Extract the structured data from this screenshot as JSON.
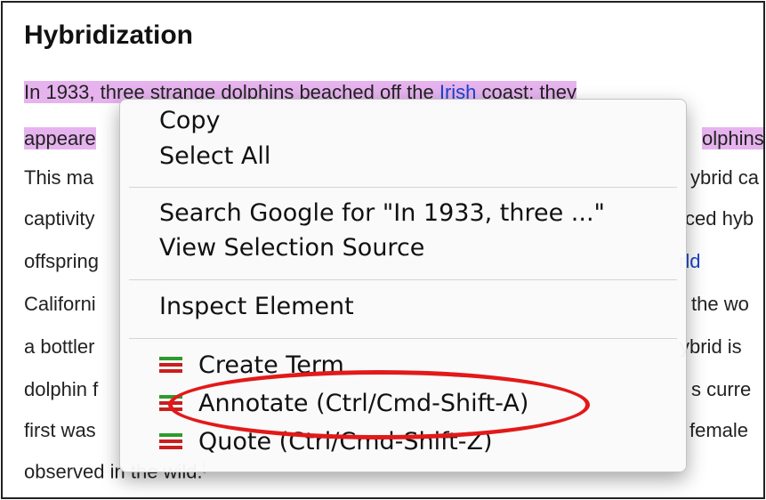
{
  "article": {
    "heading": "Hybridization",
    "lines": [
      "In 1933, three strange dolphins beached off the",
      "Irish",
      "coast; they",
      "appeare",
      "olphins",
      "This ma",
      "ybrid ca",
      "captivity",
      "ced hyb",
      "offspring",
      "rld",
      "Californi",
      "the wo",
      "a bottler",
      "ybrid is",
      "dolphin f",
      "s curre",
      "first was",
      "female",
      "observed in the wild."
    ]
  },
  "context_menu": {
    "copy": "Copy",
    "select_all": "Select All",
    "search_google": "Search Google for \"In 1933, three ...\"",
    "view_selection_source": "View Selection Source",
    "inspect_element": "Inspect Element",
    "create_term": "Create Term",
    "annotate": "Annotate (Ctrl/Cmd-Shift-A)",
    "quote": "Quote (Ctrl/Cmd-Shift-Z)"
  },
  "colors": {
    "selection": "#e6b3ee",
    "link": "#1a44c9",
    "highlight_ellipse": "#e31919"
  }
}
